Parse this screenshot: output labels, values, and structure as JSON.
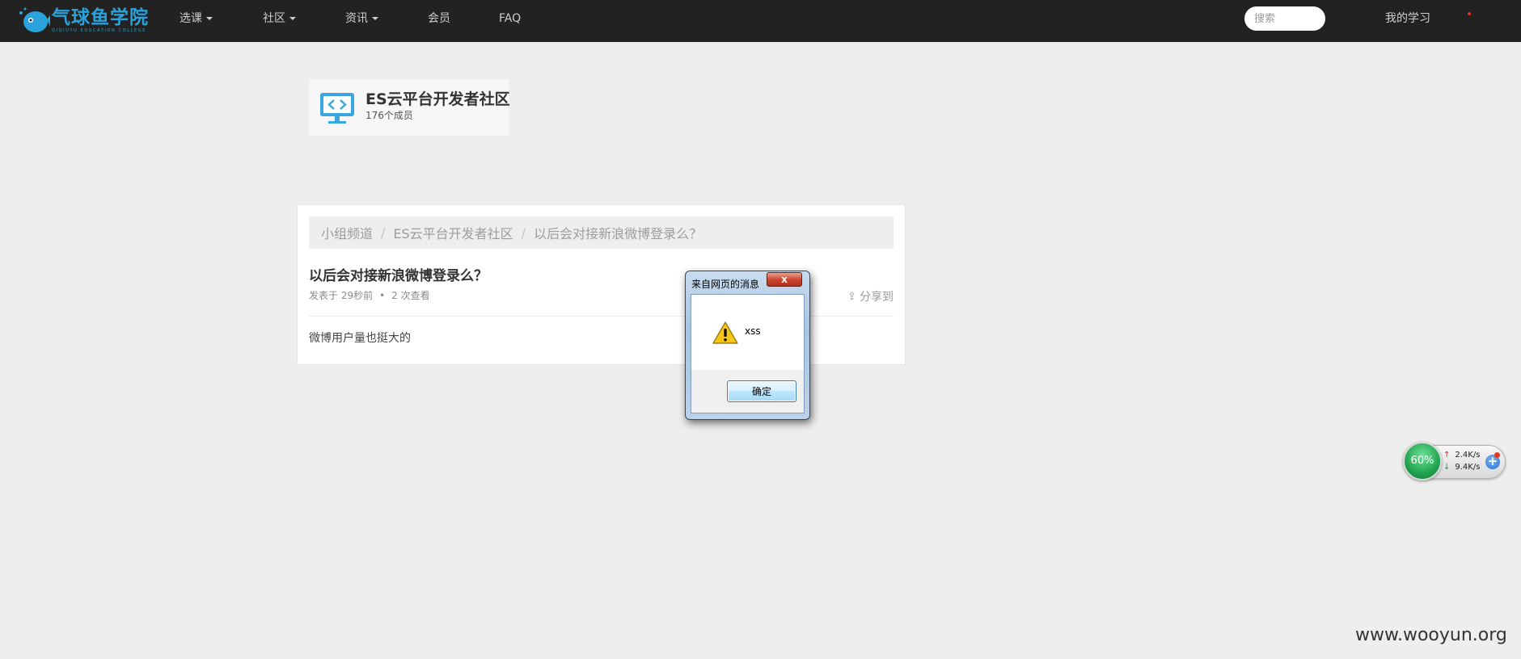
{
  "nav": {
    "logo_text": "气球鱼学院",
    "logo_sub": "QIQIUYU EDUCATION COLLEGE",
    "items": [
      "选课",
      "社区",
      "资讯",
      "会员",
      "FAQ"
    ],
    "search_placeholder": "搜索",
    "my_study": "我的学习"
  },
  "group": {
    "name": "ES云平台开发者社区",
    "members": "176个成员"
  },
  "post": {
    "breadcrumb": [
      "小组频道",
      "ES云平台开发者社区",
      "以后会对接新浪微博登录么？"
    ],
    "title": "以后会对接新浪微博登录么？",
    "meta_time": "发表于 29秒前",
    "meta_views": "2 次查看",
    "share_label": "分享到",
    "body": "微博用户量也挺大的"
  },
  "dialog": {
    "title": "来自网页的消息",
    "close": "x",
    "message": "xss",
    "ok_label": "确定"
  },
  "netmon": {
    "percent": "60%",
    "up": "2.4K/s",
    "down": "9.4K/s",
    "plus": "+"
  },
  "watermark": "www.wooyun.org",
  "colors": {
    "nav_bg": "#222222",
    "page_bg": "#eeeeee",
    "logo": "#2aa3dd"
  }
}
